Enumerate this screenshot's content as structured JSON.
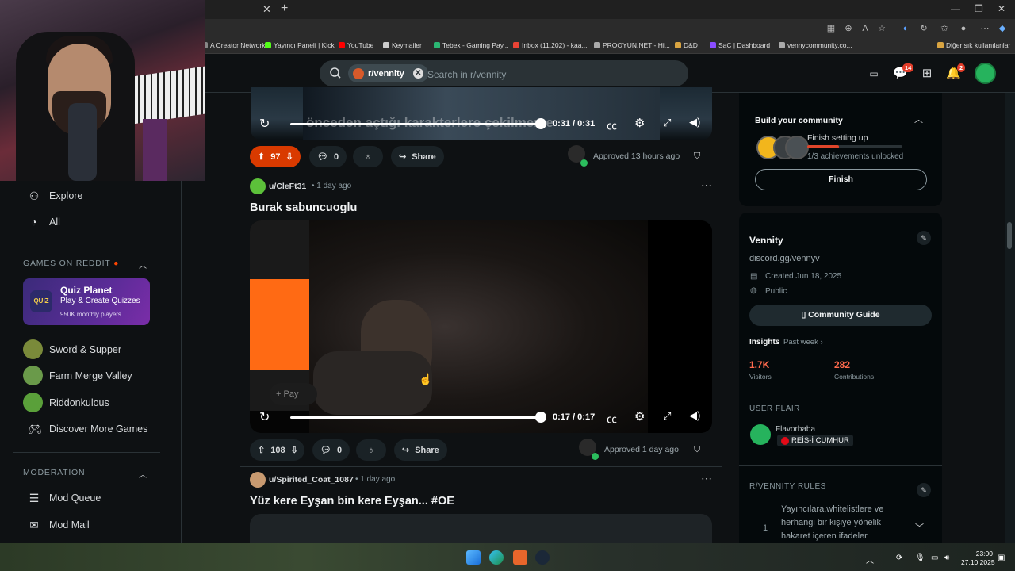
{
  "browser": {
    "bookmarks": [
      {
        "label": "A Creator Network",
        "color": "#888888"
      },
      {
        "label": "Yayıncı Paneli | Kick",
        "color": "#53fc18"
      },
      {
        "label": "YouTube",
        "color": "#ff0000"
      },
      {
        "label": "Keymailer",
        "color": "#cccccc"
      },
      {
        "label": "Tebex - Gaming Pay...",
        "color": "#2bb673"
      },
      {
        "label": "Inbox (11,202) - kaa...",
        "color": "#ea4335"
      },
      {
        "label": "PROOYUN.NET - Hi...",
        "color": "#aaaaaa"
      },
      {
        "label": "D&D",
        "color": "#d9a441"
      },
      {
        "label": "SaC | Dashboard",
        "color": "#8a4dff"
      },
      {
        "label": "vennycommunity.co...",
        "color": "#aaaaaa"
      },
      {
        "label": "Diğer sık kullanılanlar",
        "color": "#d9a441"
      }
    ]
  },
  "header": {
    "subreddit_chip": "r/vennity",
    "search_placeholder": "Search in r/vennity",
    "chat_badge": "14",
    "notif_badge": "2"
  },
  "sidebar": {
    "nav": [
      {
        "label": "Explore",
        "icon": "explore-icon"
      },
      {
        "label": "All",
        "icon": "all-icon"
      }
    ],
    "games_title": "GAMES ON REDDIT",
    "quiz": {
      "title": "Quiz Planet",
      "subtitle": "Play & Create Quizzes",
      "players": "950K monthly players",
      "icon_text": "QUIZ"
    },
    "games": [
      {
        "label": "Sword & Supper",
        "color": "#7a8a3a"
      },
      {
        "label": "Farm Merge Valley",
        "color": "#6a9a4a"
      },
      {
        "label": "Riddonkulous",
        "color": "#5aa03a"
      },
      {
        "label": "Discover More Games",
        "color": ""
      }
    ],
    "moderation_title": "MODERATION",
    "moderation": [
      {
        "label": "Mod Queue",
        "icon": "mod-queue-icon"
      },
      {
        "label": "Mod Mail",
        "icon": "mod-mail-icon"
      }
    ]
  },
  "posts": [
    {
      "video_time": "0:31 / 0:31",
      "caption": "önceden açtığı karakterlere çekilmeme",
      "upvotes": "97",
      "comments": "0",
      "share": "Share",
      "approved": "Approved 13 hours ago"
    },
    {
      "author": "u/CleFt31",
      "time": "1 day ago",
      "title": "Burak sabuncuoglu",
      "video_time": "0:17 / 0:17",
      "progress": 1.0,
      "upvotes": "108",
      "comments": "0",
      "share": "Share",
      "approved": "Approved 1 day ago",
      "overlay_btn": "Pay"
    },
    {
      "author": "u/Spirited_Coat_1087",
      "time": "1 day ago",
      "title": "Yüz kere Eyşan bin kere Eyşan... #OE"
    }
  ],
  "right": {
    "build": {
      "title": "Build your community",
      "step": "Finish setting up",
      "progress_text": "1/3 achievements unlocked",
      "progress": 0.33,
      "button": "Finish"
    },
    "about": {
      "name": "Vennity",
      "link": "discord.gg/vennyv",
      "created": "Created Jun 18, 2025",
      "visibility": "Public",
      "guide_button": "Community Guide",
      "insights": "Insights",
      "period": "Past week",
      "visitors_value": "1.7K",
      "visitors_label": "Visitors",
      "contrib_value": "282",
      "contrib_label": "Contributions"
    },
    "flair": {
      "title": "USER FLAIR",
      "username": "Flavorbaba",
      "flair_text": "REİS-İ CUMHUR"
    },
    "rules": {
      "title": "R/VENNITY RULES",
      "items": [
        {
          "num": "1",
          "text_lines": [
            "Yayıncılara,whitelistlere ve",
            "herhangi bir kişiye yönelik",
            "hakaret içeren ifadeler"
          ]
        }
      ]
    }
  },
  "taskbar": {
    "time": "23:00",
    "date": "27.10.2025"
  },
  "colors": {
    "accent_upvote": "#d93a00",
    "reddit_bg": "#0e1113",
    "green": "#26b35d"
  }
}
